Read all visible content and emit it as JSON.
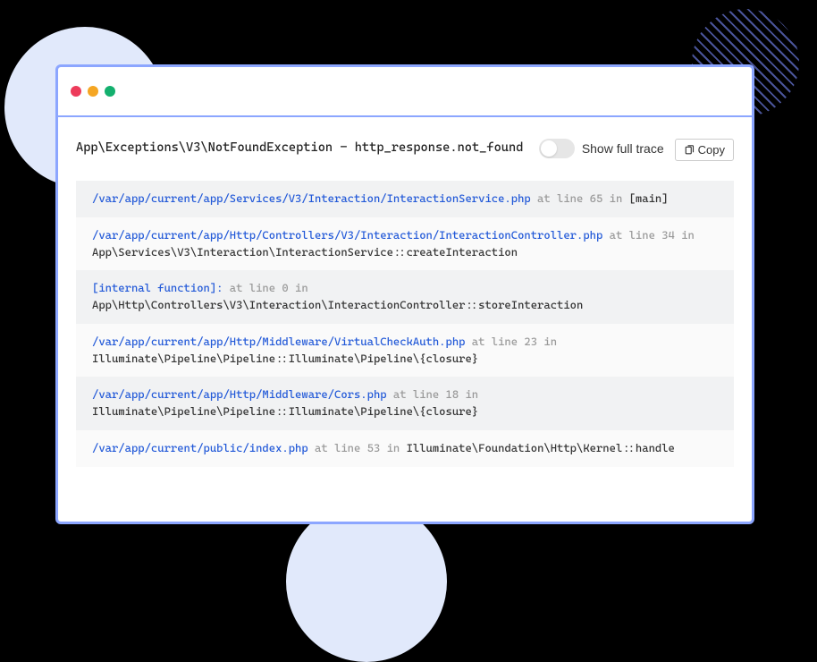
{
  "exception": {
    "class": "App\\Exceptions\\V3\\NotFoundException",
    "separator": " - ",
    "message": "http_response.not_found"
  },
  "controls": {
    "toggle_label": "Show full trace",
    "copy_label": "Copy"
  },
  "trace": [
    {
      "file": "/var/app/current/app/Services/V3/Interaction/InteractionService.php",
      "location": " at line 65  in ",
      "context": "[main]"
    },
    {
      "file": "/var/app/current/app/Http/Controllers/V3/Interaction/InteractionController.php",
      "location": " at line 34  in ",
      "context": "App\\Services\\V3\\Interaction\\InteractionService::createInteraction"
    },
    {
      "file": "[internal function]:",
      "location": " at line 0  in ",
      "context": "App\\Http\\Controllers\\V3\\Interaction\\InteractionController::storeInteraction"
    },
    {
      "file": "/var/app/current/app/Http/Middleware/VirtualCheckAuth.php",
      "location": " at line 23  in ",
      "context": "Illuminate\\Pipeline\\Pipeline::Illuminate\\Pipeline\\{closure}"
    },
    {
      "file": "/var/app/current/app/Http/Middleware/Cors.php",
      "location": " at line 18  in ",
      "context": "Illuminate\\Pipeline\\Pipeline::Illuminate\\Pipeline\\{closure}"
    },
    {
      "file": "/var/app/current/public/index.php",
      "location": " at line 53  in ",
      "context": "Illuminate\\Foundation\\Http\\Kernel::handle"
    }
  ]
}
